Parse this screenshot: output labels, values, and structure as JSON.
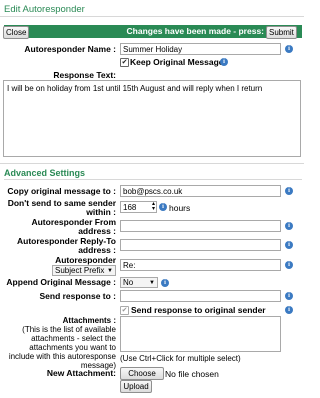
{
  "header": {
    "title": "Edit Autoresponder"
  },
  "toolbar": {
    "close_label": "Close",
    "changes_text": "Changes have been made - press:",
    "submit_label": "Submit"
  },
  "form": {
    "name_label": "Autoresponder Name :",
    "name_value": "Summer Holiday",
    "keep_original_label": "Keep Original Message",
    "keep_original_checked": true,
    "response_text_label": "Response Text:",
    "response_text_value": "I will be on holiday from 1st until 15th August and will reply when I return"
  },
  "advanced": {
    "section_title": "Advanced Settings",
    "copy_label": "Copy original message to :",
    "copy_value": "bob@pscs.co.uk",
    "dont_send_label_1": "Don't send to same sender",
    "dont_send_label_2": "within :",
    "dont_send_value": "168",
    "dont_send_unit": "hours",
    "from_label_1": "Autoresponder From",
    "from_label_2": "address :",
    "from_value": "",
    "replyto_label_1": "Autoresponder Reply-To",
    "replyto_label_2": "address :",
    "replyto_value": "",
    "subject_label": "Autoresponder",
    "subject_select": "Subject Prefix",
    "subject_value": "Re:",
    "append_label": "Append Original Message :",
    "append_value": "No",
    "send_response_label": "Send response to :",
    "send_response_value": "",
    "send_orig_label": "Send response to original sender",
    "send_orig_checked": true,
    "attachments_label": "Attachments :",
    "attachments_desc_1": "(This is the list of available",
    "attachments_desc_2": "attachments - select the",
    "attachments_desc_3": "attachments you want to",
    "attachments_desc_4": "include with this autoresponse",
    "attachments_desc_5": "message)",
    "attachments_hint": "(Use Ctrl+Click for multiple select)",
    "new_attachment_label": "New Attachment:",
    "choose_file_label": "Choose file",
    "no_file_text": "No file chosen",
    "upload_label": "Upload"
  },
  "colors": {
    "accent": "#2a8a55",
    "info": "#3b7ac2"
  }
}
